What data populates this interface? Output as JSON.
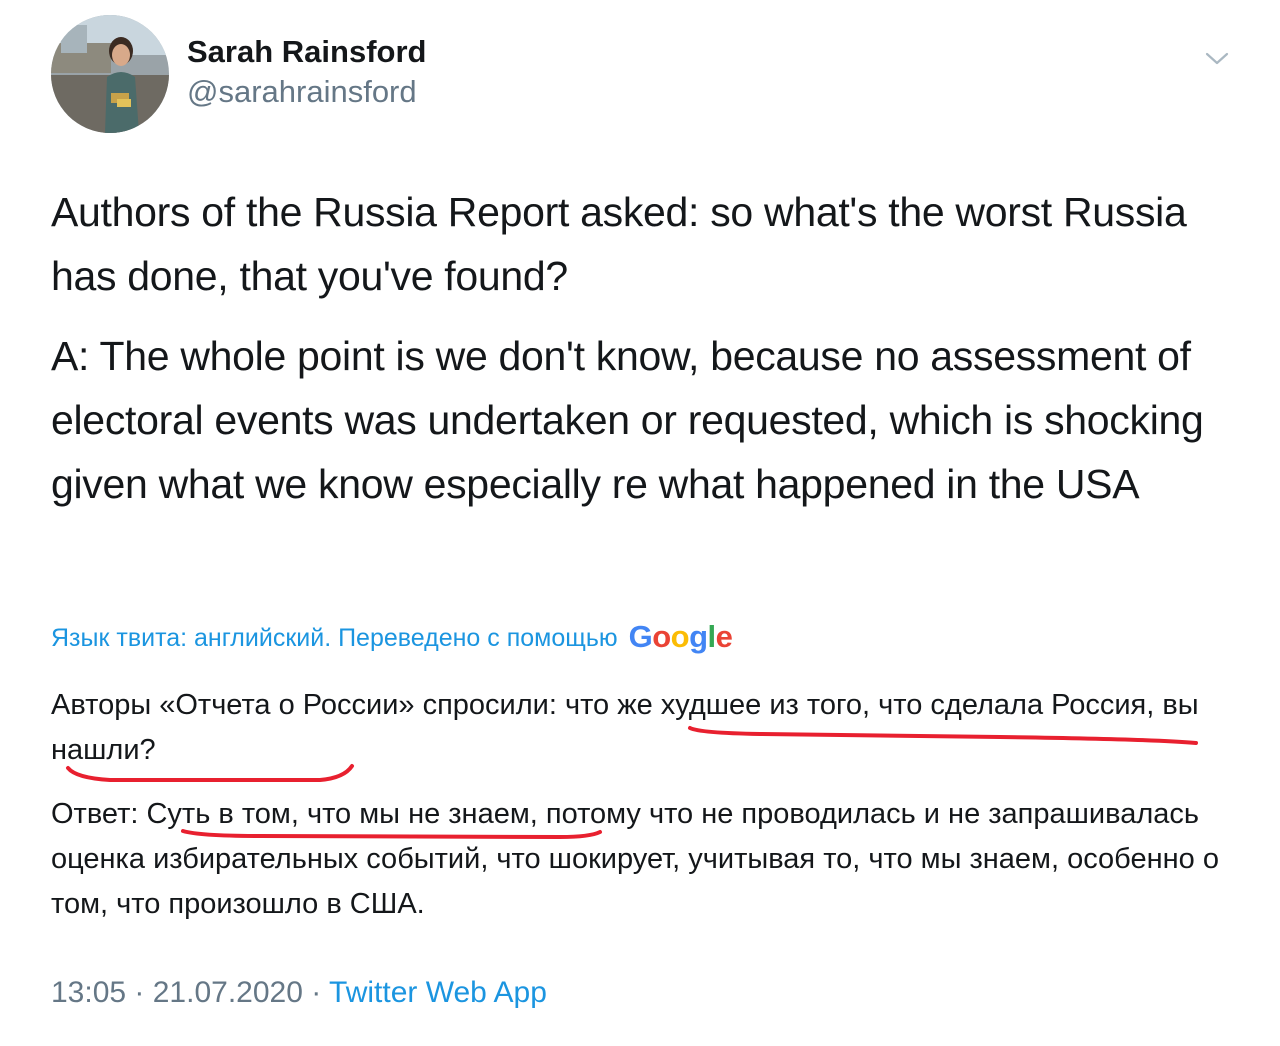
{
  "author": {
    "name": "Sarah Rainsford",
    "handle": "@sarahrainsford"
  },
  "icons": {
    "avatar": "profile-photo",
    "menu": "chevron-down-icon"
  },
  "tweet": {
    "paragraph1": "Authors of the Russia Report asked: so what's the worst Russia has done, that you've found?",
    "paragraph2": "A: The whole point is we don't know, because no assessment of electoral events was undertaken or requested, which is shocking given what we know especially re what happened in the USA"
  },
  "translation": {
    "note": "Язык твита: английский. Переведено с помощью",
    "provider": [
      "G",
      "o",
      "o",
      "g",
      "l",
      "e"
    ],
    "provider_colors": [
      "#4285F4",
      "#EA4335",
      "#FBBC05",
      "#4285F4",
      "#34A853",
      "#EA4335"
    ],
    "paragraph1": "Авторы «Отчета о России» спросили: что же худшее из того, что сделала Россия, вы нашли?",
    "paragraph2": " Ответ: Суть в том, что мы не знаем, потому что не проводилась и не запрашивалась оценка избирательных событий, что шокирует, учитывая то, что мы знаем, особенно о том, что произошло в США."
  },
  "annotation_color": "#e8202f",
  "meta": {
    "time": "13:05",
    "separator1": " · ",
    "date": "21.07.2020",
    "separator2": " · ",
    "source": "Twitter Web App"
  }
}
